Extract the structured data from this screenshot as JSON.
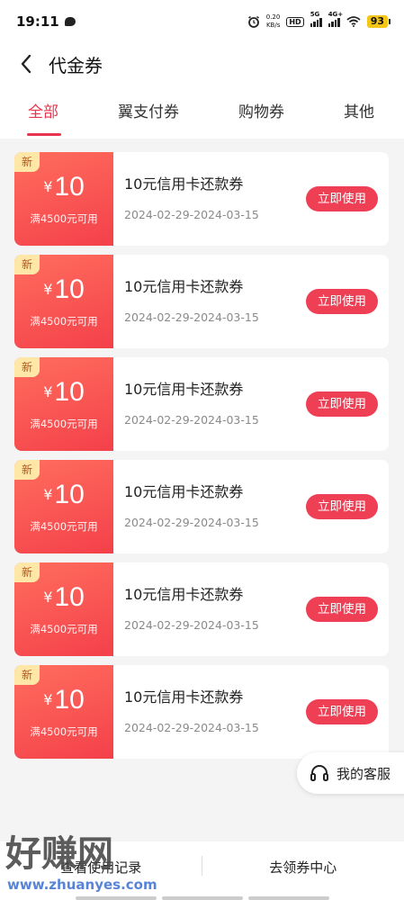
{
  "status_bar": {
    "time": "19:11",
    "net_speed_value": "0.20",
    "net_speed_unit": "KB/s",
    "hd_label": "HD",
    "signal_1_label": "5G",
    "signal_2_label": "4G+",
    "battery": "93"
  },
  "header": {
    "title": "代金券"
  },
  "tabs": [
    {
      "label": "全部",
      "active": true
    },
    {
      "label": "翼支付券",
      "active": false
    },
    {
      "label": "购物券",
      "active": false
    },
    {
      "label": "其他",
      "active": false
    }
  ],
  "coupons": [
    {
      "badge": "新",
      "currency": "¥",
      "amount": "10",
      "condition": "满4500元可用",
      "name": "10元信用卡还款券",
      "date": "2024-02-29-2024-03-15",
      "button": "立即使用"
    },
    {
      "badge": "新",
      "currency": "¥",
      "amount": "10",
      "condition": "满4500元可用",
      "name": "10元信用卡还款券",
      "date": "2024-02-29-2024-03-15",
      "button": "立即使用"
    },
    {
      "badge": "新",
      "currency": "¥",
      "amount": "10",
      "condition": "满4500元可用",
      "name": "10元信用卡还款券",
      "date": "2024-02-29-2024-03-15",
      "button": "立即使用"
    },
    {
      "badge": "新",
      "currency": "¥",
      "amount": "10",
      "condition": "满4500元可用",
      "name": "10元信用卡还款券",
      "date": "2024-02-29-2024-03-15",
      "button": "立即使用"
    },
    {
      "badge": "新",
      "currency": "¥",
      "amount": "10",
      "condition": "满4500元可用",
      "name": "10元信用卡还款券",
      "date": "2024-02-29-2024-03-15",
      "button": "立即使用"
    },
    {
      "badge": "新",
      "currency": "¥",
      "amount": "10",
      "condition": "满4500元可用",
      "name": "10元信用卡还款券",
      "date": "2024-02-29-2024-03-15",
      "button": "立即使用"
    }
  ],
  "customer_service": {
    "label": "我的客服"
  },
  "bottom_bar": {
    "left": "查看使用记录",
    "right": "去领券中心"
  },
  "watermark": {
    "brand": "好赚网",
    "url": "www.zhuanyes.com"
  },
  "colors": {
    "accent": "#e8344d",
    "button": "#ee3f55",
    "coupon_gradient_start": "#ff6e5e",
    "coupon_gradient_end": "#f4404a",
    "badge_bg": "#ffe7a8"
  }
}
